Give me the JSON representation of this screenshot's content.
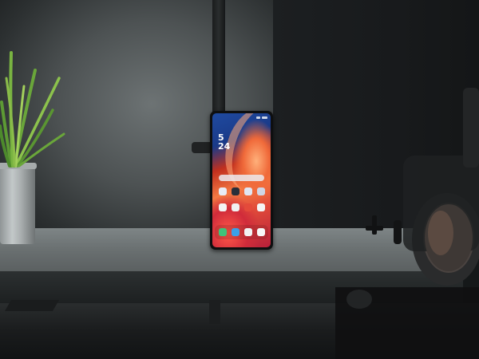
{
  "scene": {
    "description_free": true,
    "phone": {
      "lockscreen_time_hour": "5",
      "lockscreen_time_minute": "24"
    },
    "colors": {
      "wall": "#5a6061",
      "desk": "#737a7b",
      "wallpaper_orange": "#f47a43",
      "wallpaper_blue": "#1f4aa0",
      "plant_green": "#6aa63a",
      "pot_metal": "#b5babb"
    },
    "icons": [
      "plant",
      "phone",
      "camera-lens",
      "light-stand"
    ]
  }
}
